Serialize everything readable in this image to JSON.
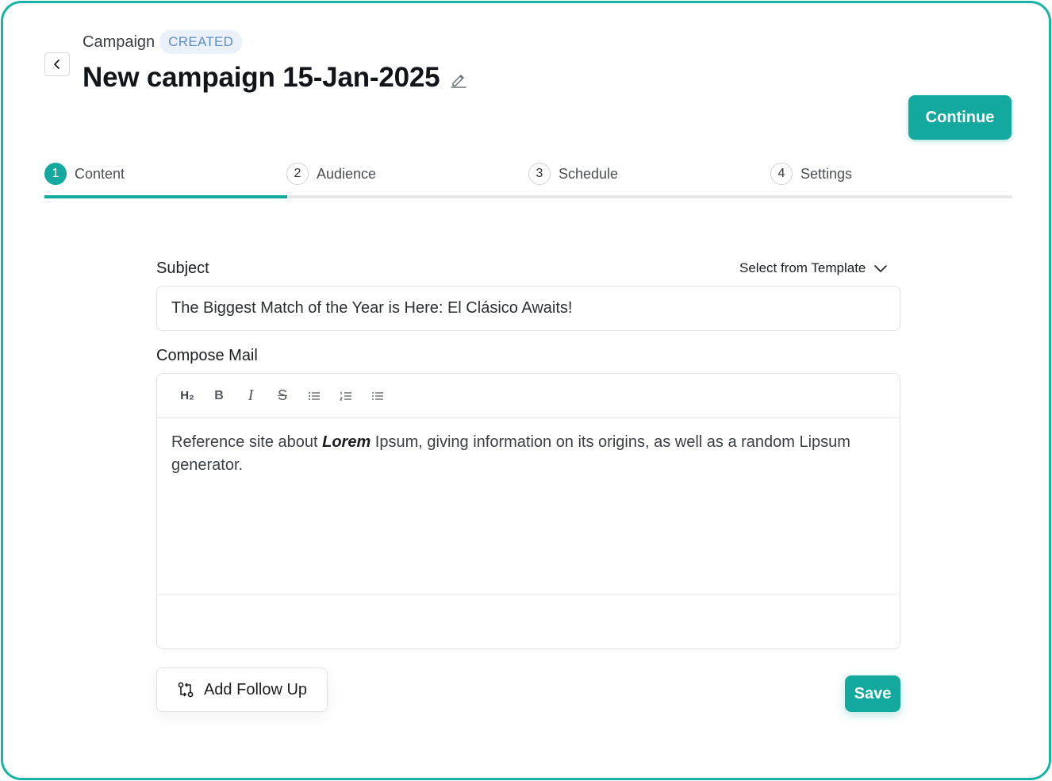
{
  "header": {
    "breadcrumb": "Campaign",
    "status_badge": "CREATED",
    "title": "New campaign 15-Jan-2025",
    "continue_label": "Continue"
  },
  "stepper": {
    "active_index": 0,
    "steps": [
      {
        "number": "1",
        "label": "Content"
      },
      {
        "number": "2",
        "label": "Audience"
      },
      {
        "number": "3",
        "label": "Schedule"
      },
      {
        "number": "4",
        "label": "Settings"
      }
    ]
  },
  "form": {
    "subject_label": "Subject",
    "template_select_label": "Select from Template",
    "subject_value": "The Biggest Match of the Year is Here: El Clásico Awaits!",
    "compose_label": "Compose Mail",
    "toolbar": {
      "h2": "H₂",
      "bold": "B",
      "italic": "I",
      "strike": "S"
    },
    "body_before": "Reference site about ",
    "body_bold": "Lorem",
    "body_after": " Ipsum, giving information on its origins, as well as a random Lipsum generator.",
    "add_follow_up_label": "Add Follow Up",
    "save_label": "Save"
  },
  "colors": {
    "accent": "#14a99f",
    "frame_border": "#17b3a6",
    "badge_text": "#5e8fc4",
    "badge_bg": "#eaf1fb"
  }
}
